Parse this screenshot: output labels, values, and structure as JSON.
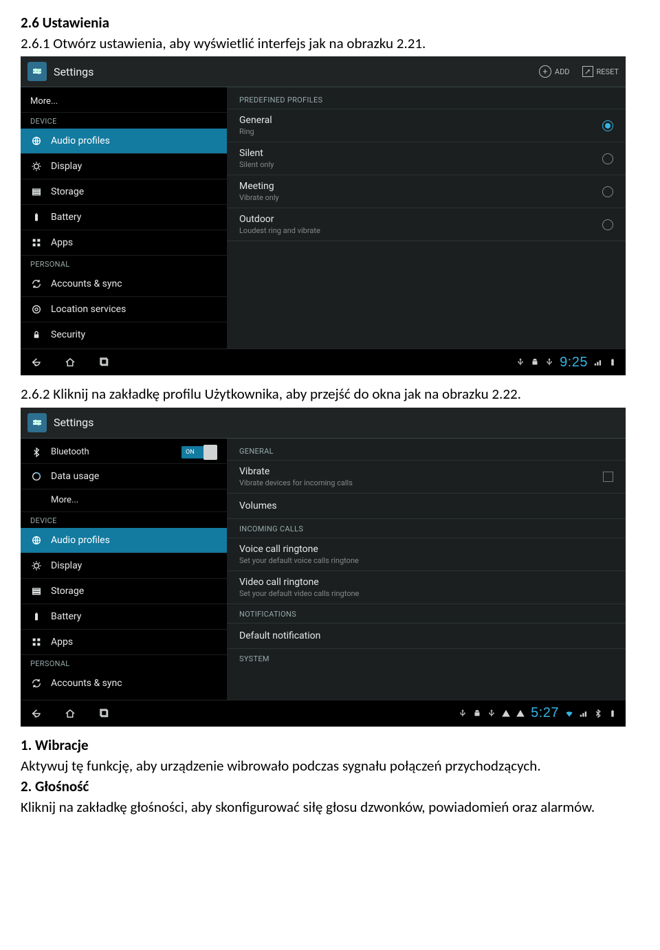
{
  "doc": {
    "heading": "2.6 Ustawienia",
    "p1": " 2.6.1 Otwórz ustawienia, aby wyświetlić interfejs jak na obrazku 2.21.",
    "p2_a": " 2.6.2 Kliknij ",
    "p2_b": "na zakładkę profilu Użytkownika, ",
    "p2_c": "aby przejść do okna jak na obrazku 2.22.",
    "wibracje_head": "1. Wibracje",
    "wibracje_body": "Aktywuj tę funkcję, aby urządzenie wibrowało podczas sygnału połączeń przychodzących.",
    "glosnosc_head": "2. Głośność",
    "glosnosc_body": "Kliknij na zakładkę głośności, aby skonfigurować siłę głosu dzwonków, powiadomień oraz alarmów."
  },
  "shot1": {
    "title": "Settings",
    "add": "ADD",
    "reset": "RESET",
    "left": {
      "more": "More...",
      "device_cat": "DEVICE",
      "audio": "Audio profiles",
      "display": "Display",
      "storage": "Storage",
      "battery": "Battery",
      "apps": "Apps",
      "personal_cat": "PERSONAL",
      "accounts": "Accounts & sync",
      "location": "Location services",
      "security": "Security"
    },
    "right": {
      "predef": "PREDEFINED PROFILES",
      "general": "General",
      "general_sub": "Ring",
      "silent": "Silent",
      "silent_sub": "Silent only",
      "meeting": "Meeting",
      "meeting_sub": "Vibrate only",
      "outdoor": "Outdoor",
      "outdoor_sub": "Loudest ring and vibrate"
    },
    "time": "9:25"
  },
  "shot2": {
    "title": "Settings",
    "toggle": "ON",
    "left": {
      "bluetooth": "Bluetooth",
      "datausage": "Data usage",
      "more": "More...",
      "device_cat": "DEVICE",
      "audio": "Audio profiles",
      "display": "Display",
      "storage": "Storage",
      "battery": "Battery",
      "apps": "Apps",
      "personal_cat": "PERSONAL",
      "accounts": "Accounts & sync"
    },
    "right": {
      "general": "GENERAL",
      "vibrate": "Vibrate",
      "vibrate_sub": "Vibrate devices for incoming calls",
      "volumes": "Volumes",
      "incoming": "INCOMING CALLS",
      "voice": "Voice call ringtone",
      "voice_sub": "Set your default voice calls ringtone",
      "video": "Video call ringtone",
      "video_sub": "Set your default video calls ringtone",
      "notif_cat": "NOTIFICATIONS",
      "default_notif": "Default notification",
      "system": "SYSTEM"
    },
    "time": "5:27"
  }
}
